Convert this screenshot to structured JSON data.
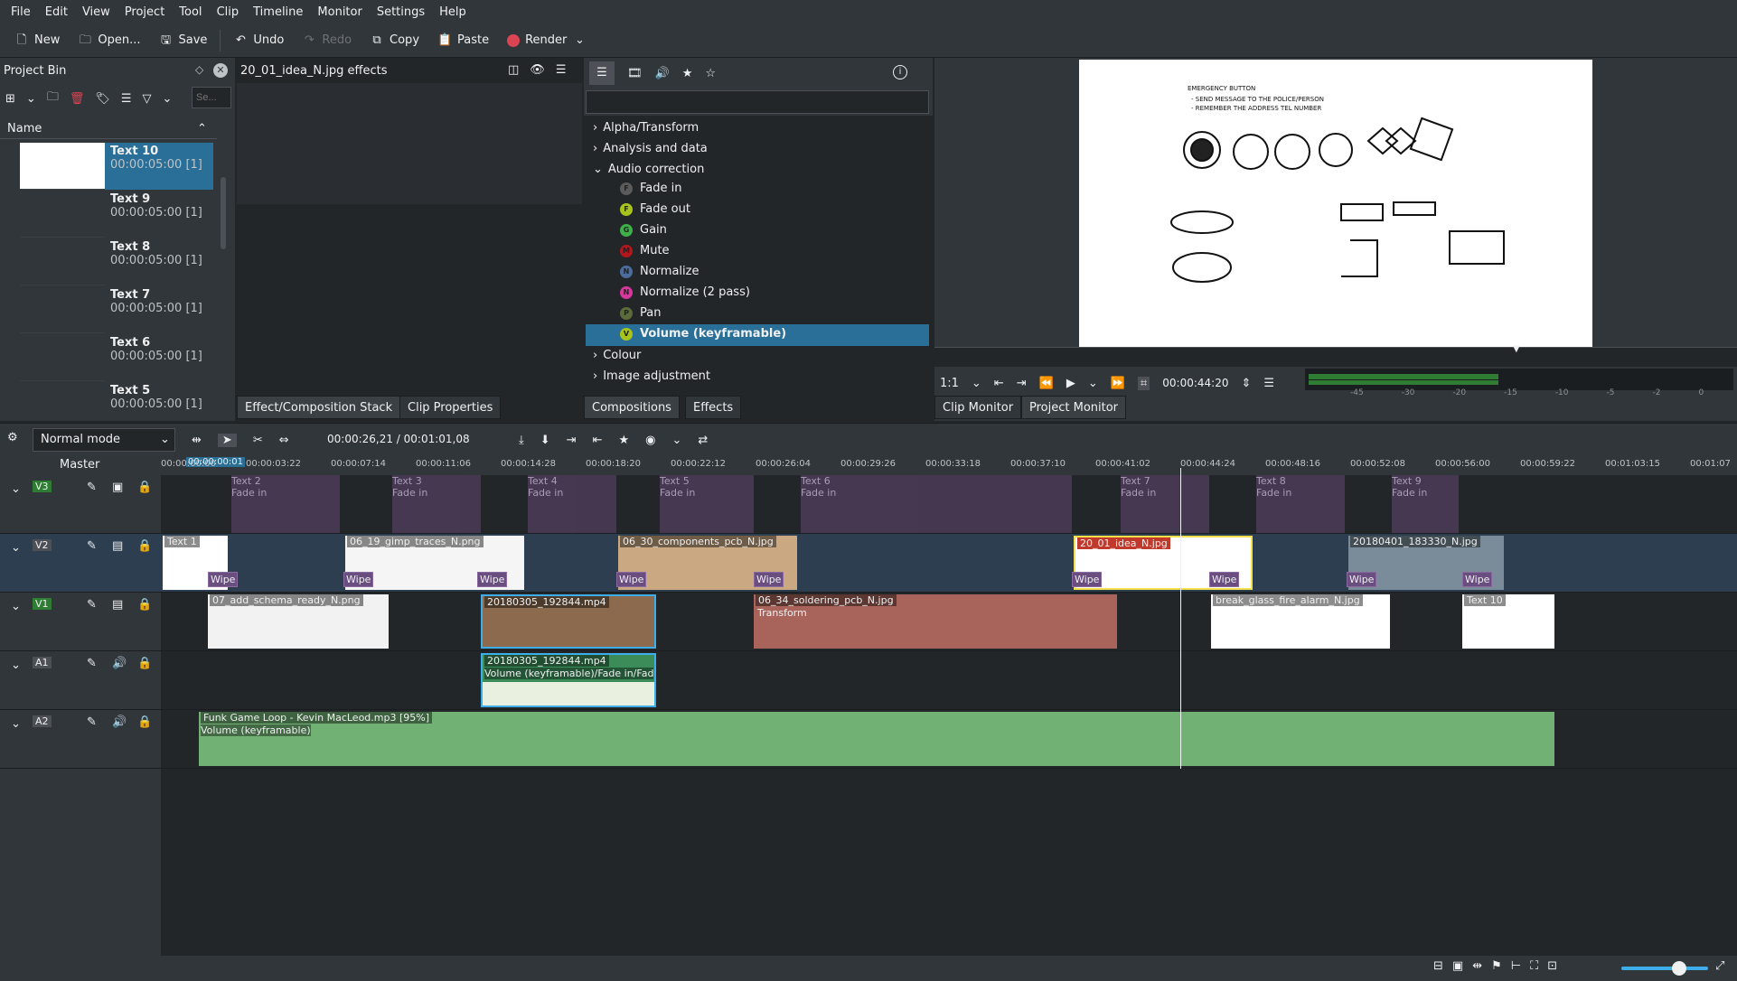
{
  "menu": [
    "File",
    "Edit",
    "View",
    "Project",
    "Tool",
    "Clip",
    "Timeline",
    "Monitor",
    "Settings",
    "Help"
  ],
  "toolbar": {
    "new": "New",
    "open": "Open...",
    "save": "Save",
    "undo": "Undo",
    "redo": "Redo",
    "copy": "Copy",
    "paste": "Paste",
    "render": "Render"
  },
  "bin": {
    "title": "Project Bin",
    "search_placeholder": "Se...",
    "column": "Name",
    "items": [
      {
        "name": "Text 10",
        "duration": "00:00:05:00 [1]"
      },
      {
        "name": "Text 9",
        "duration": "00:00:05:00 [1]"
      },
      {
        "name": "Text 8",
        "duration": "00:00:05:00 [1]"
      },
      {
        "name": "Text 7",
        "duration": "00:00:05:00 [1]"
      },
      {
        "name": "Text 6",
        "duration": "00:00:05:00 [1]"
      },
      {
        "name": "Text 5",
        "duration": "00:00:05:00 [1]"
      }
    ]
  },
  "fxstack": {
    "title": "20_01_idea_N.jpg effects"
  },
  "effects": {
    "categories": [
      "Alpha/Transform",
      "Analysis and data",
      "Audio correction",
      "Colour",
      "Image adjustment"
    ],
    "audio_items": [
      {
        "label": "Fade in",
        "letter": "F",
        "color": "#5b5b5b"
      },
      {
        "label": "Fade out",
        "letter": "F",
        "color": "#a8c41c"
      },
      {
        "label": "Gain",
        "letter": "G",
        "color": "#3fae49"
      },
      {
        "label": "Mute",
        "letter": "M",
        "color": "#b0181e"
      },
      {
        "label": "Normalize",
        "letter": "N",
        "color": "#4a6d9e"
      },
      {
        "label": "Normalize (2 pass)",
        "letter": "N",
        "color": "#d6379a"
      },
      {
        "label": "Pan",
        "letter": "P",
        "color": "#5b6b3a"
      },
      {
        "label": "Volume (keyframable)",
        "letter": "V",
        "color": "#a8c41c"
      }
    ]
  },
  "tabs_left": {
    "stack": "Effect/Composition Stack",
    "props": "Clip Properties"
  },
  "tabs_mid": {
    "comps": "Compositions",
    "effects": "Effects"
  },
  "tabs_right": {
    "clip": "Clip Monitor",
    "project": "Project Monitor"
  },
  "monitor": {
    "zoom": "1:1",
    "timecode": "00:00:44:20",
    "meter_labels": [
      "-45",
      "-30",
      "-20",
      "-15",
      "-10",
      "-5",
      "-2",
      "0"
    ],
    "note_lines": [
      "EMERGENCY BUTTON",
      "- SEND MESSAGE TO THE POLICE/PERSON",
      "- REMEMBER THE ADDRESS TEL NUMBER"
    ]
  },
  "timeline": {
    "mode": "Normal mode",
    "position": "00:00:26,21 / 00:01:01,08",
    "master": "Master",
    "playhead_label": "00:00:00:01",
    "ruler": [
      "00:00:00:00",
      "00:00:03:22",
      "00:00:07:14",
      "00:00:11:06",
      "00:00:14:28",
      "00:00:18:20",
      "00:00:22:12",
      "00:00:26:04",
      "00:00:29:26",
      "00:00:33:18",
      "00:00:37:10",
      "00:00:41:02",
      "00:00:44:24",
      "00:00:48:16",
      "00:00:52:08",
      "00:00:56:00",
      "00:00:59:22",
      "00:01:03:15",
      "00:01:07"
    ],
    "tracks": [
      "V3",
      "V2",
      "V1",
      "A1",
      "A2"
    ],
    "v3": [
      {
        "t": "Text 2",
        "s": "Fade in"
      },
      {
        "t": "Text 3",
        "s": "Fade in"
      },
      {
        "t": "Text 4",
        "s": "Fade in"
      },
      {
        "t": "Text 5",
        "s": "Fade in"
      },
      {
        "t": "Text 6",
        "s": "Fade in"
      },
      {
        "t": "Text 7",
        "s": "Fade in"
      },
      {
        "t": "Text 8",
        "s": "Fade in"
      },
      {
        "t": "Text 9",
        "s": "Fade in"
      }
    ],
    "v2": [
      "Text 1",
      "06_19_gimp_traces_N.png",
      "06_30_components_pcb_N.jpg",
      "20_01_idea_N.jpg",
      "20180401_183330_N.jpg"
    ],
    "wipe": "Wipe",
    "v1": [
      "07_add_schema_ready_N.png",
      "20180305_192844.mp4",
      "06_34_soldering_pcb_N.jpg",
      "Transform",
      "break_glass_fire_alarm_N.jpg",
      "Text 10"
    ],
    "a1": {
      "name": "20180305_192844.mp4",
      "effect": "Volume (keyframable)/Fade in/Fad"
    },
    "a2": {
      "name": "Funk Game Loop - Kevin MacLeod.mp3 [95%]",
      "effect": "Volume (keyframable)"
    }
  }
}
